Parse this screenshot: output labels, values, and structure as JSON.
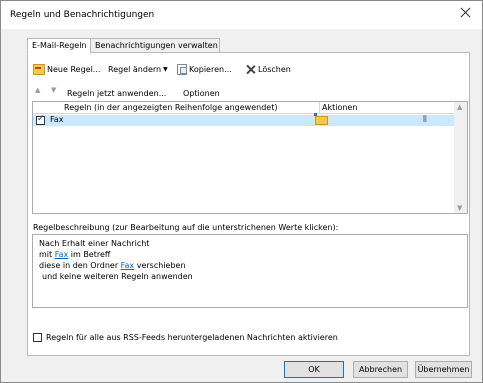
{
  "window": {
    "title": "Regeln und Benachrichtigungen"
  },
  "tabs": [
    {
      "label": "E-Mail-Regeln",
      "active": true
    },
    {
      "label": "Benachrichtigungen verwalten",
      "active": false
    }
  ],
  "toolbar": {
    "new_rule": "Neue Regel...",
    "change_rule": "Regel ändern",
    "copy": "Kopieren...",
    "delete": "Löschen"
  },
  "toolbar2": {
    "run_rules": "Regeln jetzt anwenden...",
    "options": "Optionen"
  },
  "rules_table": {
    "columns": [
      "Regeln (in der angezeigten Reihenfolge angewendet)",
      "Aktionen"
    ],
    "rows": [
      {
        "checked": true,
        "name": "Fax",
        "action_icons": [
          "move-to-folder-icon",
          "stop-processing-icon"
        ]
      }
    ]
  },
  "description": {
    "label": "Regelbeschreibung (zur Bearbeitung auf die unterstrichenen Werte klicken):",
    "line1": "Nach Erhalt einer Nachricht",
    "line2_prefix": "mit ",
    "line2_link": "Fax",
    "line2_suffix": " im Betreff",
    "line3_prefix": "diese in den Ordner ",
    "line3_link": "Fax",
    "line3_suffix": " verschieben",
    "line4": "und keine weiteren Regeln anwenden"
  },
  "rss": {
    "label": "Regeln für alle aus RSS-Feeds heruntergeladenen Nachrichten aktivieren",
    "checked": false
  },
  "buttons": {
    "ok": "OK",
    "cancel": "Abbrechen",
    "apply": "Übernehmen"
  },
  "colors": {
    "selection": "#cce8ff",
    "link": "#0066cc",
    "default_button_border": "#0078d7"
  }
}
